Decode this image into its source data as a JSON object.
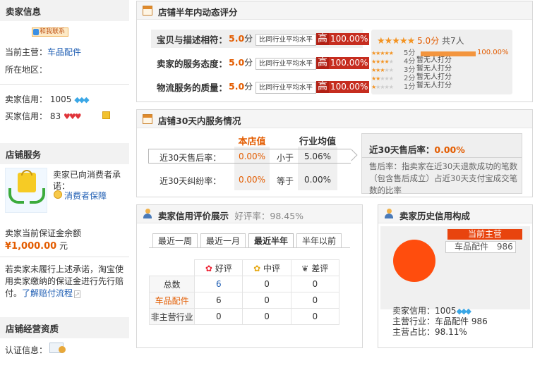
{
  "seller_info": {
    "title": "卖家信息",
    "contact_label": "和我联系",
    "main_business_label": "当前主营：",
    "main_business_value": "车品配件",
    "region_label": "所在地区：",
    "seller_credit_label": "卖家信用：",
    "seller_credit_value": "1005",
    "buyer_credit_label": "买家信用：",
    "buyer_credit_value": "83"
  },
  "store_service": {
    "title": "店铺服务",
    "promise_text": "卖家已向消费者承诺：",
    "guarantee_link": "消费者保障",
    "deposit_label": "卖家当前保证金余额",
    "deposit_amount": "¥1,000.00",
    "deposit_unit": "元",
    "note_text": "若卖家未履行上述承诺，淘宝使用卖家缴纳的保证金进行先行赔付。",
    "note_link": "了解赔付流程"
  },
  "qualification": {
    "title": "店铺经营资质",
    "cert_label": "认证信息："
  },
  "dsr": {
    "title": "店铺半年内动态评分",
    "items": [
      {
        "label": "宝贝与描述相符：",
        "score": "5.0",
        "unit": "分",
        "compare": "比同行业平均水平",
        "level": "高",
        "percent": "100.00%"
      },
      {
        "label": "卖家的服务态度：",
        "score": "5.0",
        "unit": "分",
        "compare": "比同行业平均水平",
        "level": "高",
        "percent": "100.00%"
      },
      {
        "label": "物流服务的质量：",
        "score": "5.0",
        "unit": "分",
        "compare": "比同行业平均水平",
        "level": "高",
        "percent": "100.00%"
      }
    ],
    "summary_score": "5.0分",
    "summary_count": "共7人",
    "dist": [
      {
        "label": "5分",
        "value": "100.00%",
        "fill": 1.0
      },
      {
        "label": "4分",
        "value": "暂无人打分",
        "fill": 0
      },
      {
        "label": "3分",
        "value": "暂无人打分",
        "fill": 0
      },
      {
        "label": "2分",
        "value": "暂无人打分",
        "fill": 0
      },
      {
        "label": "1分",
        "value": "暂无人打分",
        "fill": 0
      }
    ]
  },
  "service30": {
    "title": "店铺30天内服务情况",
    "col_store": "本店值",
    "col_avg": "行业均值",
    "rows": [
      {
        "label": "近30天售后率：",
        "store": "0.00%",
        "cmp": "小于",
        "avg": "5.06%"
      },
      {
        "label": "近30天纠纷率：",
        "store": "0.00%",
        "cmp": "等于",
        "avg": "0.00%"
      }
    ],
    "tip_title": "近30天售后率：",
    "tip_value": "0.00%",
    "tip_text": "售后率：指卖家在近30天退款成功的笔数（包含售后成立）占近30天支付宝成交笔数的比率"
  },
  "credit_eval": {
    "title": "卖家信用评价展示",
    "rate_label": "好评率：",
    "rate_value": "98.45%",
    "tabs": [
      "最近一周",
      "最近一月",
      "最近半年",
      "半年以前"
    ],
    "active_tab": 2,
    "headers": [
      "好评",
      "中评",
      "差评"
    ],
    "rows": [
      {
        "label": "总数",
        "good": "6",
        "mid": "0",
        "bad": "0"
      },
      {
        "label": "车品配件",
        "good": "6",
        "mid": "0",
        "bad": "0"
      },
      {
        "label": "非主营行业",
        "good": "0",
        "mid": "0",
        "bad": "0"
      }
    ]
  },
  "credit_history": {
    "title": "卖家历史信用构成",
    "current_label": "当前主营",
    "legend_name": "车品配件",
    "legend_value": "986",
    "seller_credit_label": "卖家信用：",
    "seller_credit_value": "1005",
    "main_industry_label": "主营行业：",
    "main_industry_value": "车品配件 986",
    "main_ratio_label": "主营占比：",
    "main_ratio_value": "98.11%"
  },
  "chart_data": {
    "type": "pie",
    "categories": [
      "车品配件"
    ],
    "values": [
      986
    ]
  },
  "colors": {
    "accent": "#e35c00",
    "pie": "#ff4d0d",
    "high": "#c62d1f",
    "link": "#1f5eb3"
  }
}
